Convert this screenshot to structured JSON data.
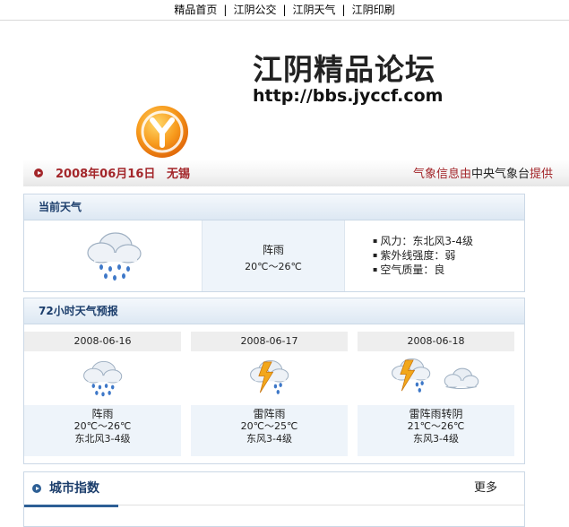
{
  "nav": {
    "items": [
      "精品首页",
      "江阴公交",
      "江阴天气",
      "江阴印刷"
    ],
    "separator": "|"
  },
  "logo": {
    "title": "江阴精品论坛",
    "url": "http://bbs.jyccf.com"
  },
  "datebar": {
    "date": "2008年06月16日",
    "city": "无锡",
    "source_prefix": "气象信息由",
    "source_org": "中央气象台",
    "source_suffix": "提供"
  },
  "current": {
    "header": "当前天气",
    "icon": "rain-cloud-icon",
    "weather": "阵雨",
    "temp": "20℃～26℃",
    "details": [
      "风力：东北风3-4级",
      "紫外线强度：弱",
      "空气质量：良"
    ]
  },
  "forecast": {
    "header": "72小时天气预报",
    "days": [
      {
        "date": "2008-06-16",
        "weather": "阵雨",
        "temp": "20℃～26℃",
        "wind": "东北风3-4级",
        "icons": [
          "rain-cloud-icon"
        ]
      },
      {
        "date": "2008-06-17",
        "weather": "雷阵雨",
        "temp": "20℃～25℃",
        "wind": "东风3-4级",
        "icons": [
          "thunderstorm-icon"
        ]
      },
      {
        "date": "2008-06-18",
        "weather": "雷阵雨转阴",
        "temp": "21℃～26℃",
        "wind": "东风3-4级",
        "icons": [
          "thunderstorm-icon",
          "overcast-icon"
        ]
      }
    ]
  },
  "city_index": {
    "title": "城市指数",
    "more": "更多"
  },
  "colors": {
    "accent_red": "#a3262a",
    "header_blue": "#1b3d6b",
    "panel_border": "#cbd8e6"
  }
}
